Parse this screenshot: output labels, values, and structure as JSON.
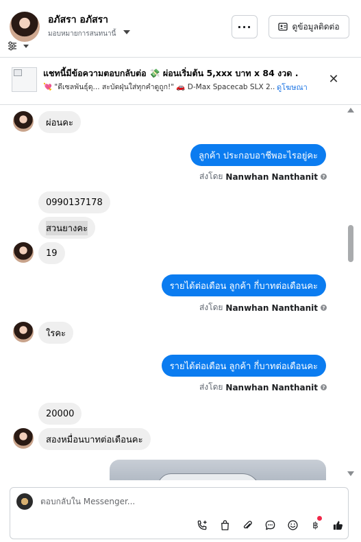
{
  "header": {
    "name": "อภัสรา อภัสรา",
    "assign_label": "มอบหมายการสนทนานี้",
    "contact_button": "ดูข้อมูลติดต่อ"
  },
  "ad": {
    "title": "แชทนี้มีข้อความตอบกลับต่อ 💸 ผ่อนเริ่มต้น 5,xxx บาท x 84 งวด .",
    "subtitle": "💘 \"ดีเซลพันธุ์ดุ... สะบัดฝุ่นใส่ทุกคำดูถูก!\" 🚗 D-Max Spacecab SLX 2....",
    "link": "ดูโฆษณา"
  },
  "messages": {
    "m1": "ผ่อนคะ",
    "m2": "ลูกค้า ประกอบอาชีพอะไรอยู่คะ",
    "m3": "0990137178",
    "m4": "สวนยางคะ",
    "m5": "19",
    "m6": "รายได้ต่อเดือน ลูกค้า  กี่บาทต่อเดือนคะ",
    "m7": "ใรคะ",
    "m8": "รายได้ต่อเดือน ลูกค้า  กี่บาทต่อเดือนคะ",
    "m9": "20000",
    "m10": "สองหมื่อนบาทต่อเดือนคะ"
  },
  "sent_by": {
    "prefix": "ส่งโดย",
    "agent": "Nanwhan Nanthanit"
  },
  "composer": {
    "placeholder": "ตอบกลับใน Messenger..."
  },
  "colors": {
    "outgoing_bubble": "#0b7cf0",
    "incoming_bubble": "#efefef",
    "link": "#1b74e4"
  }
}
